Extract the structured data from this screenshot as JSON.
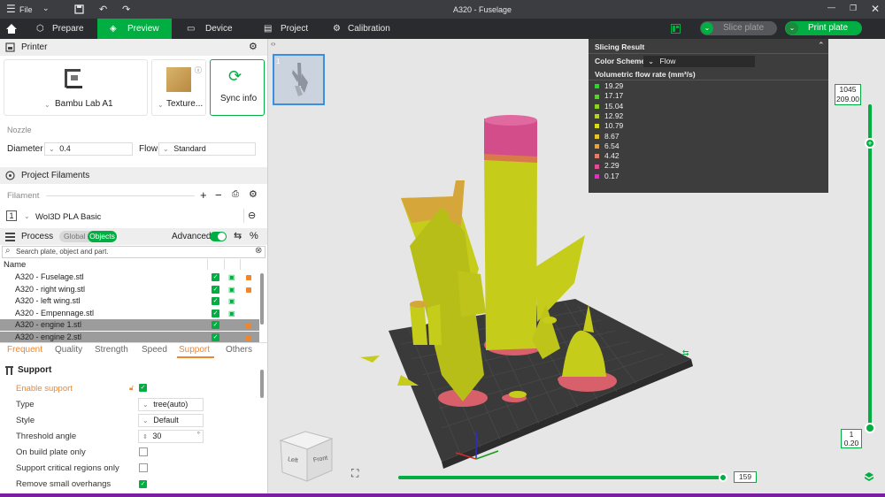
{
  "titlebar": {
    "menu_label": "File",
    "title": "A320 - Fuselage"
  },
  "nav": {
    "prepare": "Prepare",
    "preview": "Preview",
    "device": "Device",
    "project": "Project",
    "calibration": "Calibration",
    "slice_plate": "Slice plate",
    "print_plate": "Print plate"
  },
  "printer": {
    "header": "Printer",
    "model": "Bambu Lab A1",
    "plate": "Texture...",
    "sync": "Sync info",
    "nozzle_label": "Nozzle",
    "diameter_label": "Diameter",
    "diameter_value": "0.4",
    "flow_label": "Flow",
    "flow_value": "Standard"
  },
  "filaments": {
    "header": "Project Filaments",
    "filament_label": "Filament",
    "item_index": "1",
    "item_name": "Wol3D PLA Basic"
  },
  "process": {
    "header": "Process",
    "toggle_global": "Global",
    "toggle_objects": "Objects",
    "advanced_label": "Advanced",
    "search_placeholder": "Search plate, object and part.",
    "col_name": "Name"
  },
  "objects": [
    {
      "name": "A320 - Fuselage.stl",
      "selected": false
    },
    {
      "name": "A320 - right wing.stl",
      "selected": false
    },
    {
      "name": "A320 - left wing.stl",
      "selected": false
    },
    {
      "name": "A320 - Empennage.stl",
      "selected": false
    },
    {
      "name": "A320 - engine 1.stl",
      "selected": true
    },
    {
      "name": "A320 - engine 2.stl",
      "selected": true
    }
  ],
  "subtabs": {
    "frequent": "Frequent",
    "quality": "Quality",
    "strength": "Strength",
    "speed": "Speed",
    "support": "Support",
    "others": "Others"
  },
  "support": {
    "header": "Support",
    "enable_label": "Enable support",
    "type_label": "Type",
    "type_value": "tree(auto)",
    "style_label": "Style",
    "style_value": "Default",
    "threshold_label": "Threshold angle",
    "threshold_value": "30",
    "buildplate_label": "On build plate only",
    "critical_label": "Support critical regions only",
    "overhangs_label": "Remove small overhangs"
  },
  "legend": {
    "title": "Slicing Result",
    "scheme_label": "Color Scheme",
    "scheme_value": "Flow",
    "subtitle": "Volumetric flow rate (mm³/s)",
    "items": [
      {
        "value": "19.29",
        "color": "#29d62c"
      },
      {
        "value": "17.17",
        "color": "#5ad328"
      },
      {
        "value": "15.04",
        "color": "#8bd225"
      },
      {
        "value": "12.92",
        "color": "#b4d51f"
      },
      {
        "value": "10.79",
        "color": "#d8dc1a"
      },
      {
        "value": "8.67",
        "color": "#e7c32d"
      },
      {
        "value": "6.54",
        "color": "#e6a53c"
      },
      {
        "value": "4.42",
        "color": "#de7f69"
      },
      {
        "value": "2.29",
        "color": "#e04d94"
      },
      {
        "value": "0.17",
        "color": "#e62bc7"
      }
    ]
  },
  "layers": {
    "top_count": "1045",
    "top_height": "209.00",
    "bottom_count": "1",
    "bottom_height": "0.20",
    "top_fraction": 1.0
  },
  "moves": {
    "value": "159",
    "fraction": 1.0
  },
  "viewcube": {
    "left": "Left",
    "front": "Front"
  },
  "plate": {
    "number": "1"
  },
  "colors": {
    "accent": "#00ae42",
    "model": "#c6cc1a",
    "support": "#d7606a",
    "bed": "#3a3a3a"
  }
}
